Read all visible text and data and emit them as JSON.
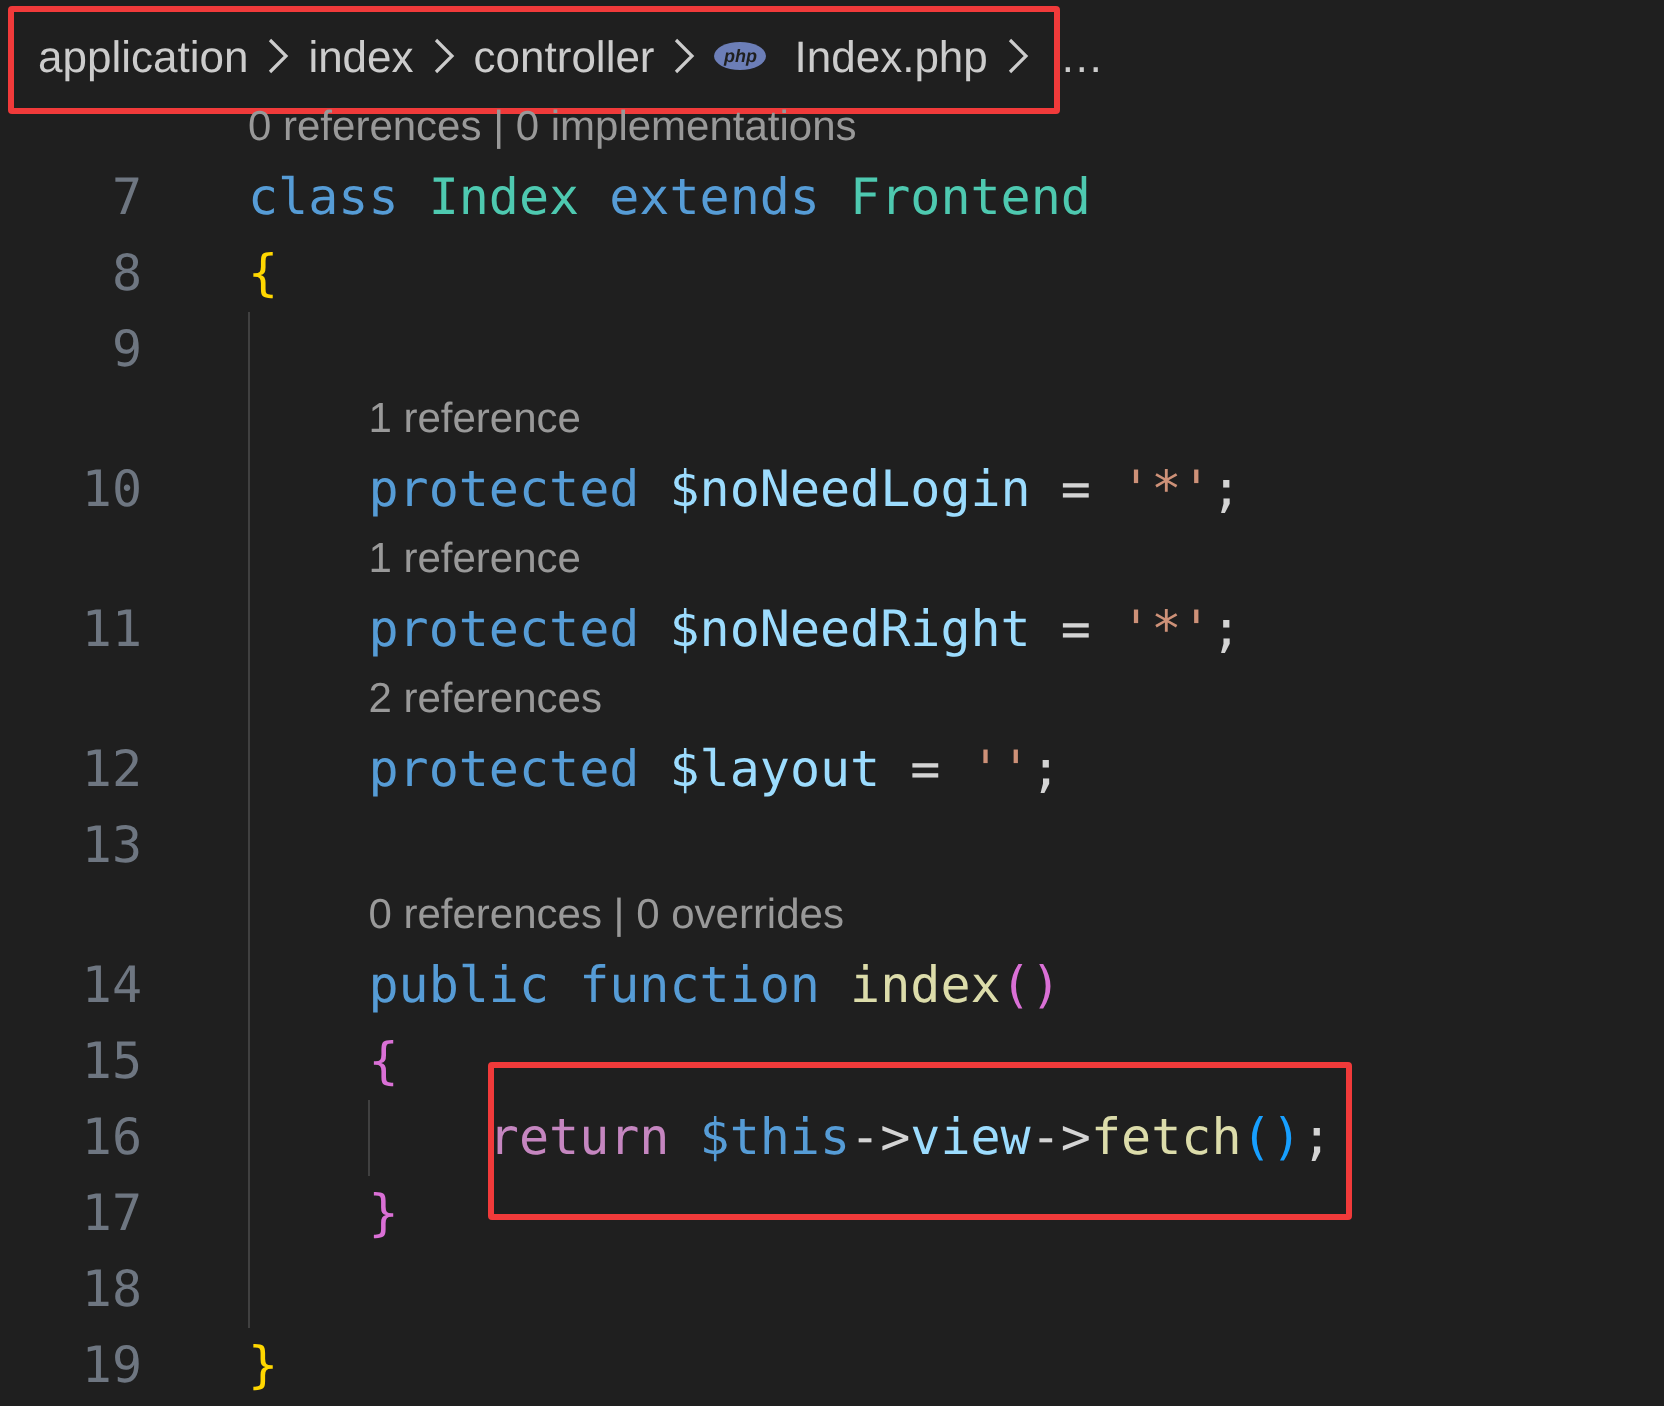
{
  "breadcrumb": {
    "annotated": true,
    "segments": [
      {
        "kind": "folder",
        "text": "application"
      },
      {
        "kind": "folder",
        "text": "index"
      },
      {
        "kind": "folder",
        "text": "controller"
      },
      {
        "kind": "file",
        "icon_label": "php",
        "text": "Index.php"
      }
    ],
    "overflow": "…"
  },
  "lines": [
    {
      "kind": "codelens",
      "text": "0 references | 0 implementations"
    },
    {
      "kind": "code",
      "number": "7",
      "tokens": [
        {
          "kind": "keyword",
          "text": "class "
        },
        {
          "kind": "type",
          "text": "Index "
        },
        {
          "kind": "keyword",
          "text": "extends "
        },
        {
          "kind": "type",
          "text": "Frontend"
        }
      ]
    },
    {
      "kind": "code",
      "number": "8",
      "tokens": [
        {
          "kind": "bracket1",
          "text": "{"
        }
      ]
    },
    {
      "kind": "code",
      "number": "9"
    },
    {
      "kind": "codelens",
      "text": "    1 reference"
    },
    {
      "kind": "code",
      "number": "10",
      "tokens": [
        {
          "kind": "keyword",
          "text": "    protected "
        },
        {
          "kind": "variable",
          "text": "$noNeedLogin "
        },
        {
          "kind": "plain",
          "text": "= "
        },
        {
          "kind": "string",
          "text": "'*'"
        },
        {
          "kind": "plain",
          "text": ";"
        }
      ]
    },
    {
      "kind": "codelens",
      "text": "    1 reference"
    },
    {
      "kind": "code",
      "number": "11",
      "tokens": [
        {
          "kind": "keyword",
          "text": "    protected "
        },
        {
          "kind": "variable",
          "text": "$noNeedRight "
        },
        {
          "kind": "plain",
          "text": "= "
        },
        {
          "kind": "string",
          "text": "'*'"
        },
        {
          "kind": "plain",
          "text": ";"
        }
      ]
    },
    {
      "kind": "codelens",
      "text": "    2 references"
    },
    {
      "kind": "code",
      "number": "12",
      "tokens": [
        {
          "kind": "keyword",
          "text": "    protected "
        },
        {
          "kind": "variable",
          "text": "$layout "
        },
        {
          "kind": "plain",
          "text": "= "
        },
        {
          "kind": "string",
          "text": "''"
        },
        {
          "kind": "plain",
          "text": ";"
        }
      ]
    },
    {
      "kind": "code",
      "number": "13"
    },
    {
      "kind": "codelens",
      "text": "    0 references | 0 overrides"
    },
    {
      "kind": "code",
      "number": "14",
      "tokens": [
        {
          "kind": "keyword",
          "text": "    public "
        },
        {
          "kind": "keyword",
          "text": "function "
        },
        {
          "kind": "function",
          "text": "index"
        },
        {
          "kind": "bracket2",
          "text": "()"
        }
      ]
    },
    {
      "kind": "code",
      "number": "15",
      "tokens": [
        {
          "kind": "bracket2",
          "text": "    {"
        }
      ]
    },
    {
      "kind": "code",
      "number": "16",
      "annotated": true,
      "tokens": [
        {
          "kind": "control",
          "text": "        return "
        },
        {
          "kind": "keyword",
          "text": "$this"
        },
        {
          "kind": "plain",
          "text": "->"
        },
        {
          "kind": "variable",
          "text": "view"
        },
        {
          "kind": "plain",
          "text": "->"
        },
        {
          "kind": "function",
          "text": "fetch"
        },
        {
          "kind": "bracket3",
          "text": "()"
        },
        {
          "kind": "plain",
          "text": ";"
        }
      ]
    },
    {
      "kind": "code",
      "number": "17",
      "tokens": [
        {
          "kind": "bracket2",
          "text": "    }"
        }
      ]
    },
    {
      "kind": "code",
      "number": "18"
    },
    {
      "kind": "code",
      "number": "19",
      "tokens": [
        {
          "kind": "bracket1",
          "text": "}"
        }
      ]
    }
  ]
}
